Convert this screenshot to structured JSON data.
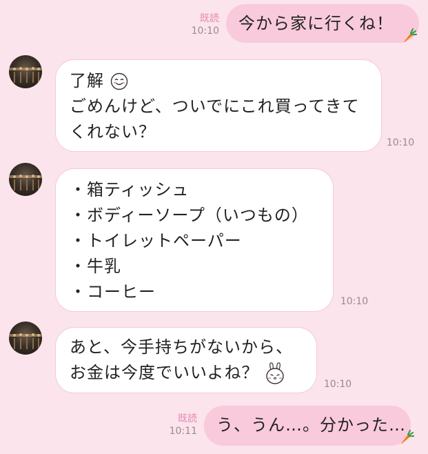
{
  "messages": [
    {
      "side": "out",
      "read_label": "既読",
      "time": "10:10",
      "lines": [
        "今から家に行くね！"
      ]
    },
    {
      "side": "in",
      "time": "10:10",
      "lines": [
        "了解",
        "ごめんけど、ついでにこれ買ってきて",
        "くれない？"
      ],
      "emoji": "smiling-face-emoji"
    },
    {
      "side": "in",
      "time": "10:10",
      "lines": [
        "・箱ティッシュ",
        "・ボディーソープ（いつもの）",
        "・トイレットペーパー",
        "・牛乳",
        "・コーヒー"
      ]
    },
    {
      "side": "in",
      "time": "10:10",
      "lines": [
        "あと、今手持ちがないから、",
        "お金は今度でいいよね？"
      ],
      "emoji": "bunny-sticker-emoji"
    },
    {
      "side": "out",
      "read_label": "既読",
      "time": "10:11",
      "lines": [
        "う、うん…。分かった…"
      ]
    }
  ],
  "colors": {
    "background": "#fbe4ec",
    "outgoing_bubble": "#f9cadb",
    "incoming_bubble": "#ffffff",
    "read_label": "#e589b0",
    "carrot_orange": "#f07a1a",
    "carrot_leaf": "#3aa04a"
  },
  "icons": [
    "carrot-icon",
    "avatar",
    "smiling-face-emoji",
    "bunny-sticker-emoji"
  ]
}
